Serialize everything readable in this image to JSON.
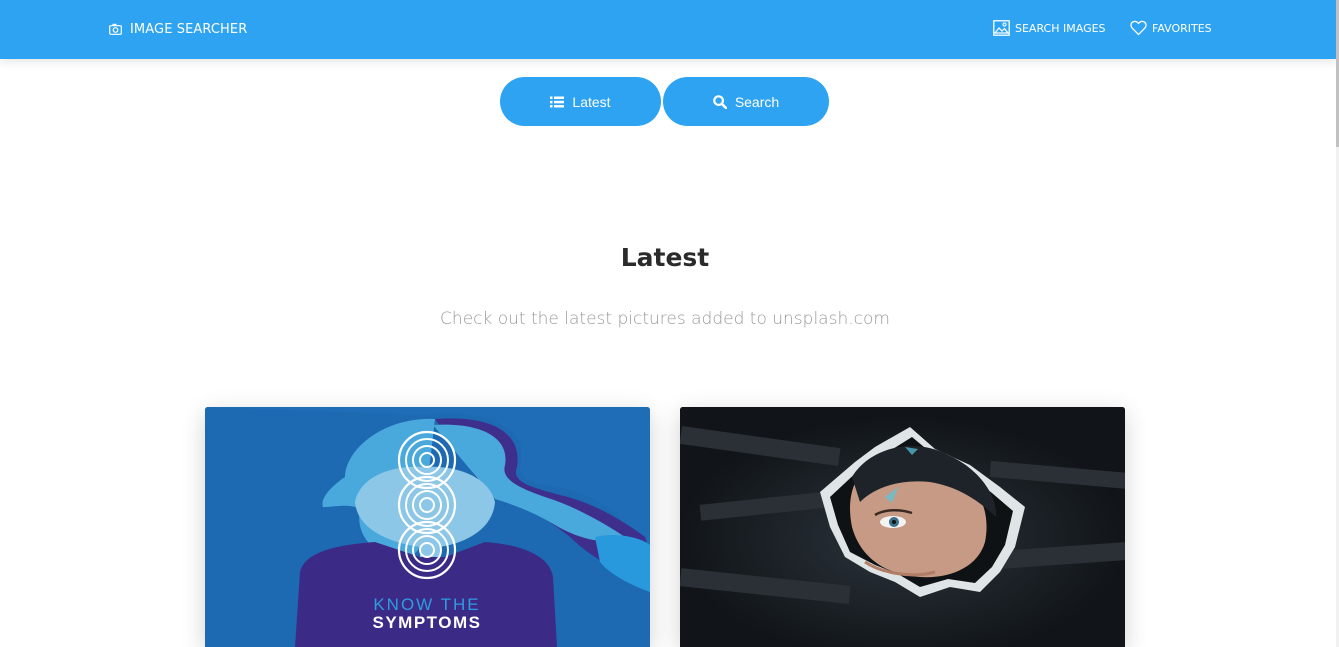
{
  "navbar": {
    "brand_label": "IMAGE SEARCHER",
    "brand_icon": "camera-icon",
    "links": [
      {
        "label": "SEARCH IMAGES",
        "icon": "image-icon"
      },
      {
        "label": "FAVORITES",
        "icon": "heart-icon"
      }
    ],
    "color": "#2ea3f2"
  },
  "toggle": {
    "latest_label": "Latest",
    "latest_icon": "list-icon",
    "search_label": "Search",
    "search_icon": "search-icon"
  },
  "section": {
    "title": "Latest",
    "subtitle": "Check out the latest pictures added to unsplash.com"
  },
  "cards": [
    {
      "image_text_line1": "KNOW THE",
      "image_text_line2": "SYMPTOMS"
    },
    {
      "image_text_line1": "",
      "image_text_line2": ""
    }
  ]
}
